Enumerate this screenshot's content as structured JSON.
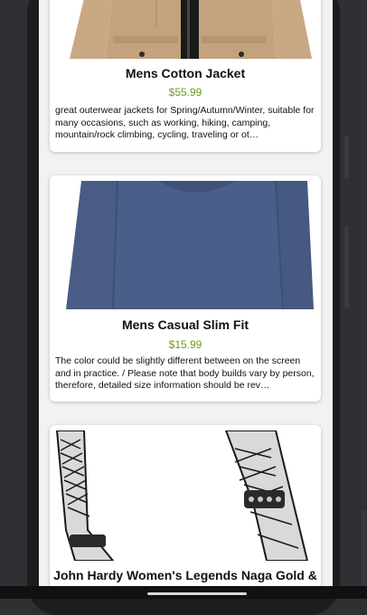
{
  "products": [
    {
      "title": "Mens Cotton Jacket",
      "price": "$55.99",
      "description": "great outerwear jackets for Spring/Autumn/Winter, suitable for many occasions, such as working, hiking, camping, mountain/rock climbing, cycling, traveling or ot…",
      "image": "jacket-image"
    },
    {
      "title": "Mens Casual Slim Fit",
      "price": "$15.99",
      "description": "The color could be slightly different between on the screen and in practice. / Please note that body builds vary by person, therefore, detailed size information should be rev…",
      "image": "tshirt-image"
    },
    {
      "title": "John Hardy Women's Legends Naga Gold &",
      "price": "",
      "description": "",
      "image": "bracelet-image"
    }
  ],
  "colors": {
    "price": "#6e9b1f",
    "background": "#f2f2f2",
    "card": "#ffffff"
  }
}
